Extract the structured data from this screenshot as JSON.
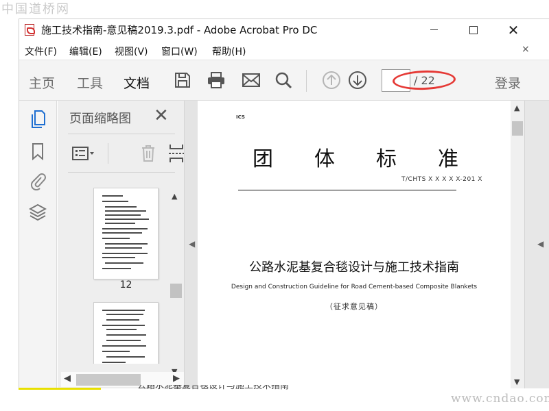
{
  "watermarks": {
    "top": "中国道桥网",
    "bottom": "www.cndao.com"
  },
  "window": {
    "title": "施工技术指南-意见稿2019.3.pdf - Adobe Acrobat Pro DC",
    "close_glyph": "✕"
  },
  "menu": {
    "items": [
      "文件(F)",
      "编辑(E)",
      "视图(V)",
      "窗口(W)",
      "帮助(H)"
    ],
    "close_glyph": "×"
  },
  "toolbar": {
    "tabs": [
      "主页",
      "工具",
      "文档"
    ],
    "active_tab": "文档",
    "icons": [
      "save-icon",
      "print-icon",
      "email-icon",
      "search-icon",
      "prev-page-icon",
      "next-page-icon"
    ],
    "page_input_value": "",
    "page_total": "/ 22",
    "login": "登录",
    "annotation_color": "#e53935"
  },
  "sidebar": {
    "icons": [
      "page-thumbnails-icon",
      "bookmark-icon",
      "attachment-icon",
      "layers-icon"
    ],
    "accent": "#1f6fd1"
  },
  "thumbnails": {
    "panel_title": "页面缩略图",
    "close_glyph": "✕",
    "pages": [
      {
        "label": "12"
      },
      {
        "label": ""
      }
    ]
  },
  "document": {
    "ics": "ICS",
    "heading": [
      "团",
      "体",
      "标",
      "准"
    ],
    "code": "T/CHTS  X X X X X-201 X",
    "cn_title": "公路水泥基复合毯设计与施工技术指南",
    "en_title": "Design and Construction Guideline for Road Cement-based Composite Blankets",
    "draft": "（征求意见稿）"
  },
  "bottom": {
    "peek_text": "公路水泥基复合毯设计与施工技术指南",
    "bar_color": "#e8e000"
  }
}
